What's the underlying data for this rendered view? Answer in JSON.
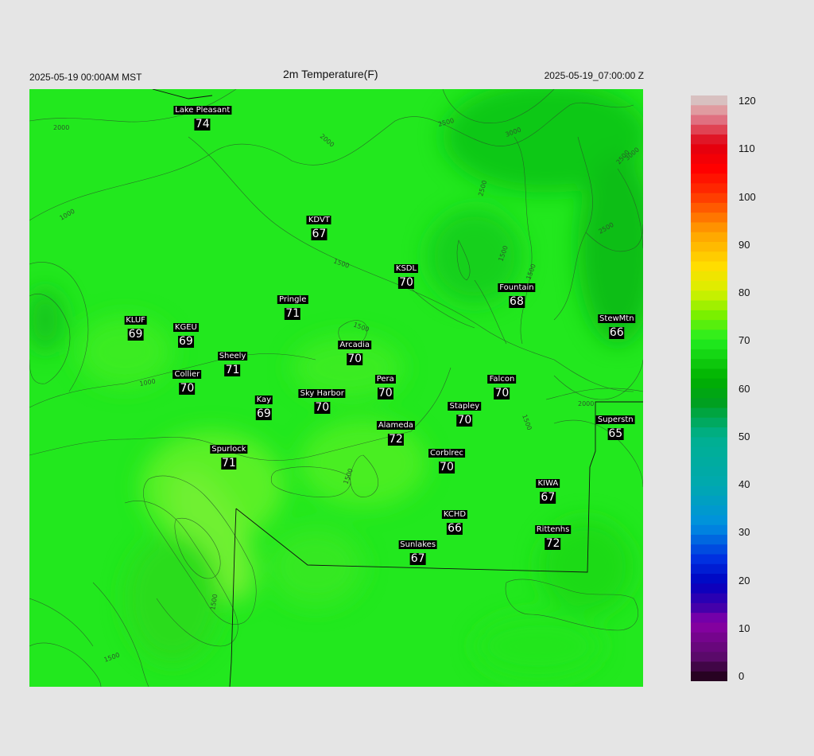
{
  "header": {
    "left_time": "2025-05-19 00:00AM MST",
    "title": "2m Temperature(F)",
    "right_time": "2025-05-19_07:00:00 Z"
  },
  "stations": [
    {
      "name": "Lake Pleasant",
      "value": "74",
      "nx": 0.282,
      "ny": 0.043
    },
    {
      "name": "KDVT",
      "value": "67",
      "nx": 0.472,
      "ny": 0.226
    },
    {
      "name": "KSDL",
      "value": "70",
      "nx": 0.614,
      "ny": 0.307
    },
    {
      "name": "Fountain",
      "value": "68",
      "nx": 0.794,
      "ny": 0.34
    },
    {
      "name": "StewMtn",
      "value": "66",
      "nx": 0.957,
      "ny": 0.392
    },
    {
      "name": "Pringle",
      "value": "71",
      "nx": 0.429,
      "ny": 0.359
    },
    {
      "name": "KLUF",
      "value": "69",
      "nx": 0.173,
      "ny": 0.394
    },
    {
      "name": "KGEU",
      "value": "69",
      "nx": 0.255,
      "ny": 0.406
    },
    {
      "name": "Arcadia",
      "value": "70",
      "nx": 0.53,
      "ny": 0.436
    },
    {
      "name": "Sheely",
      "value": "71",
      "nx": 0.331,
      "ny": 0.454
    },
    {
      "name": "Collier",
      "value": "70",
      "nx": 0.257,
      "ny": 0.485
    },
    {
      "name": "Pera",
      "value": "70",
      "nx": 0.58,
      "ny": 0.493
    },
    {
      "name": "Falcon",
      "value": "70",
      "nx": 0.77,
      "ny": 0.493
    },
    {
      "name": "Kay",
      "value": "69",
      "nx": 0.382,
      "ny": 0.527
    },
    {
      "name": "Sky Harbor",
      "value": "70",
      "nx": 0.477,
      "ny": 0.517
    },
    {
      "name": "Stapley",
      "value": "70",
      "nx": 0.709,
      "ny": 0.538
    },
    {
      "name": "Superstn",
      "value": "65",
      "nx": 0.955,
      "ny": 0.561
    },
    {
      "name": "Alameda",
      "value": "72",
      "nx": 0.597,
      "ny": 0.57
    },
    {
      "name": "Spurlock",
      "value": "71",
      "nx": 0.325,
      "ny": 0.61
    },
    {
      "name": "Corblrec",
      "value": "70",
      "nx": 0.68,
      "ny": 0.616
    },
    {
      "name": "KIWA",
      "value": "67",
      "nx": 0.845,
      "ny": 0.667
    },
    {
      "name": "KCHD",
      "value": "66",
      "nx": 0.693,
      "ny": 0.719
    },
    {
      "name": "Rittenhs",
      "value": "72",
      "nx": 0.853,
      "ny": 0.744
    },
    {
      "name": "Sunlakes",
      "value": "67",
      "nx": 0.633,
      "ny": 0.77
    }
  ],
  "contour_labels": [
    "2000",
    "2000",
    "2500",
    "3000",
    "2500",
    "2500",
    "3000",
    "2500",
    "1500",
    "1500",
    "1500",
    "1000",
    "1000",
    "2000",
    "1500",
    "1500",
    "1500",
    "1500",
    "1500"
  ],
  "colorbar": {
    "ticks": [
      "120",
      "110",
      "100",
      "90",
      "80",
      "70",
      "60",
      "50",
      "40",
      "30",
      "20",
      "10",
      "0"
    ],
    "min": 0,
    "max": 120,
    "stops": [
      {
        "v": 0,
        "c": "#1a0010"
      },
      {
        "v": 5,
        "c": "#5a0a6a"
      },
      {
        "v": 12,
        "c": "#8a00a8"
      },
      {
        "v": 15,
        "c": "#4400aa"
      },
      {
        "v": 20,
        "c": "#0000c0"
      },
      {
        "v": 25,
        "c": "#0030e0"
      },
      {
        "v": 32,
        "c": "#0090e0"
      },
      {
        "v": 40,
        "c": "#00a8b0"
      },
      {
        "v": 50,
        "c": "#00b090"
      },
      {
        "v": 57,
        "c": "#00a020"
      },
      {
        "v": 62,
        "c": "#00b000"
      },
      {
        "v": 70,
        "c": "#22ee20"
      },
      {
        "v": 75,
        "c": "#7af000"
      },
      {
        "v": 80,
        "c": "#d8f000"
      },
      {
        "v": 85,
        "c": "#ffdd00"
      },
      {
        "v": 92,
        "c": "#ffa000"
      },
      {
        "v": 100,
        "c": "#ff3000"
      },
      {
        "v": 105,
        "c": "#ff0000"
      },
      {
        "v": 110,
        "c": "#e00010"
      },
      {
        "v": 115,
        "c": "#e07080"
      },
      {
        "v": 118,
        "c": "#e0b0b0"
      },
      {
        "v": 120,
        "c": "#d0d0d0"
      }
    ]
  },
  "colors": {
    "field": "#22e81e",
    "contour": "#2a5a2a",
    "boundary": "#111111"
  }
}
